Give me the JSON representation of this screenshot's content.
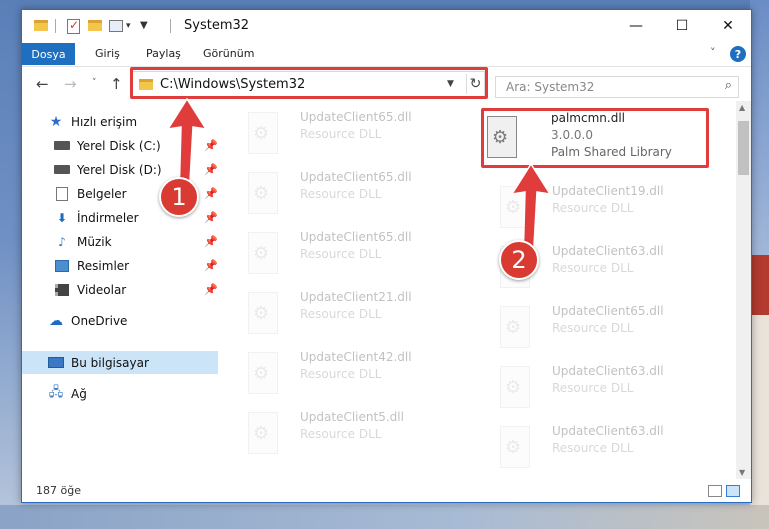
{
  "window": {
    "title": "System32",
    "controls": [
      "—",
      "☐",
      "✕"
    ]
  },
  "ribbon": {
    "tabs": [
      "Dosya",
      "Giriş",
      "Paylaş",
      "Görünüm"
    ],
    "help": "?"
  },
  "nav": {
    "back": "←",
    "forward": "→",
    "recent": "˅",
    "up": "↑",
    "address": "C:\\Windows\\System32",
    "refresh": "↻",
    "search_placeholder": "Ara: System32",
    "search_icon": "⌕"
  },
  "sidebar": {
    "items": [
      {
        "label": "Hızlı erişim",
        "icon": "star-icon"
      },
      {
        "label": "Yerel Disk (C:)",
        "icon": "drive-icon",
        "pinned": true
      },
      {
        "label": "Yerel Disk (D:)",
        "icon": "drive-icon",
        "pinned": true
      },
      {
        "label": "Belgeler",
        "icon": "document-icon",
        "pinned": true
      },
      {
        "label": "İndirmeler",
        "icon": "download-icon",
        "pinned": true
      },
      {
        "label": "Müzik",
        "icon": "music-icon",
        "pinned": true
      },
      {
        "label": "Resimler",
        "icon": "pictures-icon",
        "pinned": true
      },
      {
        "label": "Videolar",
        "icon": "videos-icon",
        "pinned": true
      },
      {
        "label": "OneDrive",
        "icon": "cloud-icon"
      },
      {
        "label": "Bu bilgisayar",
        "icon": "computer-icon",
        "selected": true
      },
      {
        "label": "Ağ",
        "icon": "network-icon"
      }
    ]
  },
  "files": {
    "left": [
      {
        "name": "UpdateClient65.dll",
        "type": "Resource DLL"
      },
      {
        "name": "UpdateClient65.dll",
        "type": "Resource DLL"
      },
      {
        "name": "UpdateClient65.dll",
        "type": "Resource DLL"
      },
      {
        "name": "UpdateClient21.dll",
        "type": "Resource DLL"
      },
      {
        "name": "UpdateClient42.dll",
        "type": "Resource DLL"
      },
      {
        "name": "UpdateClient5.dll",
        "type": "Resource DLL"
      }
    ],
    "highlighted": {
      "name": "palmcmn.dll",
      "version": "3.0.0.0",
      "description": "Palm Shared Library"
    },
    "right": [
      {
        "name": "UpdateClient19.dll",
        "type": "Resource DLL"
      },
      {
        "name": "UpdateClient63.dll",
        "type": "Resource DLL"
      },
      {
        "name": "UpdateClient65.dll",
        "type": "Resource DLL"
      },
      {
        "name": "UpdateClient63.dll",
        "type": "Resource DLL"
      },
      {
        "name": "UpdateClient63.dll",
        "type": "Resource DLL"
      }
    ]
  },
  "status": {
    "count": "187 öğe"
  },
  "annotations": {
    "badge1": "1",
    "badge2": "2",
    "color": "#e03c3c"
  }
}
